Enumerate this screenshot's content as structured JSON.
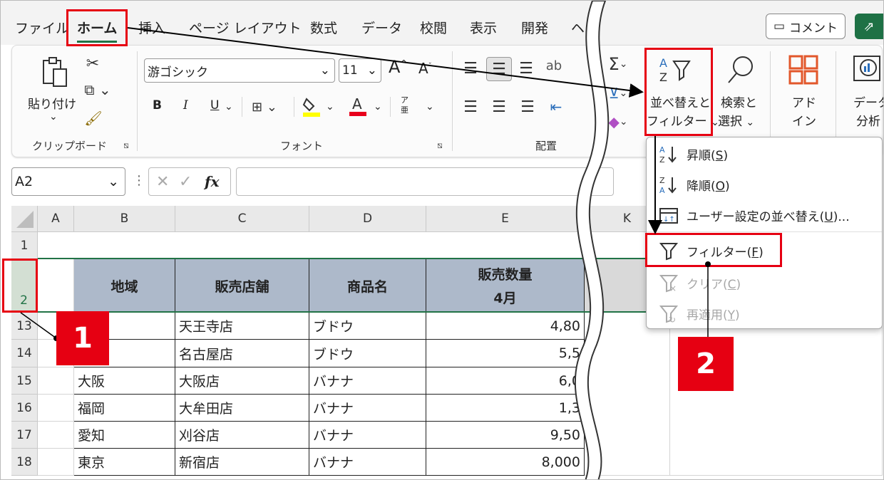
{
  "menu": {
    "tabs": [
      "ファイル",
      "ホーム",
      "挿入",
      "ページ レイアウト",
      "数式",
      "データ",
      "校閲",
      "表示",
      "開発",
      "ヘ"
    ],
    "comment_label": "コメント"
  },
  "ribbon": {
    "paste_label": "貼り付け",
    "clipboard_group": "クリップボード",
    "font_name": "游ゴシック",
    "font_size": "11",
    "bold": "B",
    "italic": "I",
    "underline": "U",
    "font_group": "フォント",
    "align_group": "配置",
    "sort_filter_label_1": "並べ替えと",
    "sort_filter_label_2": "フィルター",
    "find_label_1": "検索と",
    "find_label_2": "選択",
    "addin_label_1": "アド",
    "addin_label_2": "イン",
    "data_analysis_1": "データ",
    "data_analysis_2": "分析"
  },
  "formula_bar": {
    "name_box": "A2",
    "fx": "fx",
    "formula": ""
  },
  "grid": {
    "columns": [
      "A",
      "B",
      "C",
      "D",
      "E",
      "K"
    ],
    "row_numbers": [
      "1",
      "2",
      "13",
      "14",
      "15",
      "16",
      "17",
      "18"
    ],
    "header_row": {
      "region": "地域",
      "store": "販売店舗",
      "product": "商品名",
      "qty_1": "販売数量",
      "qty_2": "4月"
    },
    "rows": [
      {
        "region": "",
        "store": "天王寺店",
        "product": "ブドウ",
        "qty": "4,80"
      },
      {
        "region": "",
        "store": "名古屋店",
        "product": "ブドウ",
        "qty": "5,5"
      },
      {
        "region": "大阪",
        "store": "大阪店",
        "product": "バナナ",
        "qty": "6,0"
      },
      {
        "region": "福岡",
        "store": "大牟田店",
        "product": "バナナ",
        "qty": "1,3"
      },
      {
        "region": "愛知",
        "store": "刈谷店",
        "product": "バナナ",
        "qty": "9,50"
      },
      {
        "region": "東京",
        "store": "新宿店",
        "product": "バナナ",
        "qty": "8,000"
      }
    ]
  },
  "dropdown": {
    "items": [
      {
        "text": "昇順(",
        "key": "S",
        "end": ")"
      },
      {
        "text": "降順(",
        "key": "O",
        "end": ")"
      },
      {
        "text": "ユーザー設定の並べ替え(",
        "key": "U",
        "end": ")..."
      },
      {
        "text": "フィルター(",
        "key": "F",
        "end": ")"
      },
      {
        "text": "クリア(",
        "key": "C",
        "end": ")"
      },
      {
        "text": "再適用(",
        "key": "Y",
        "end": ")"
      }
    ]
  },
  "annotations": {
    "badge_1": "1",
    "badge_2": "2",
    "highlight_color": "#e60012"
  },
  "colors": {
    "header_fill": "#adb9ca",
    "excel_green": "#217346"
  }
}
